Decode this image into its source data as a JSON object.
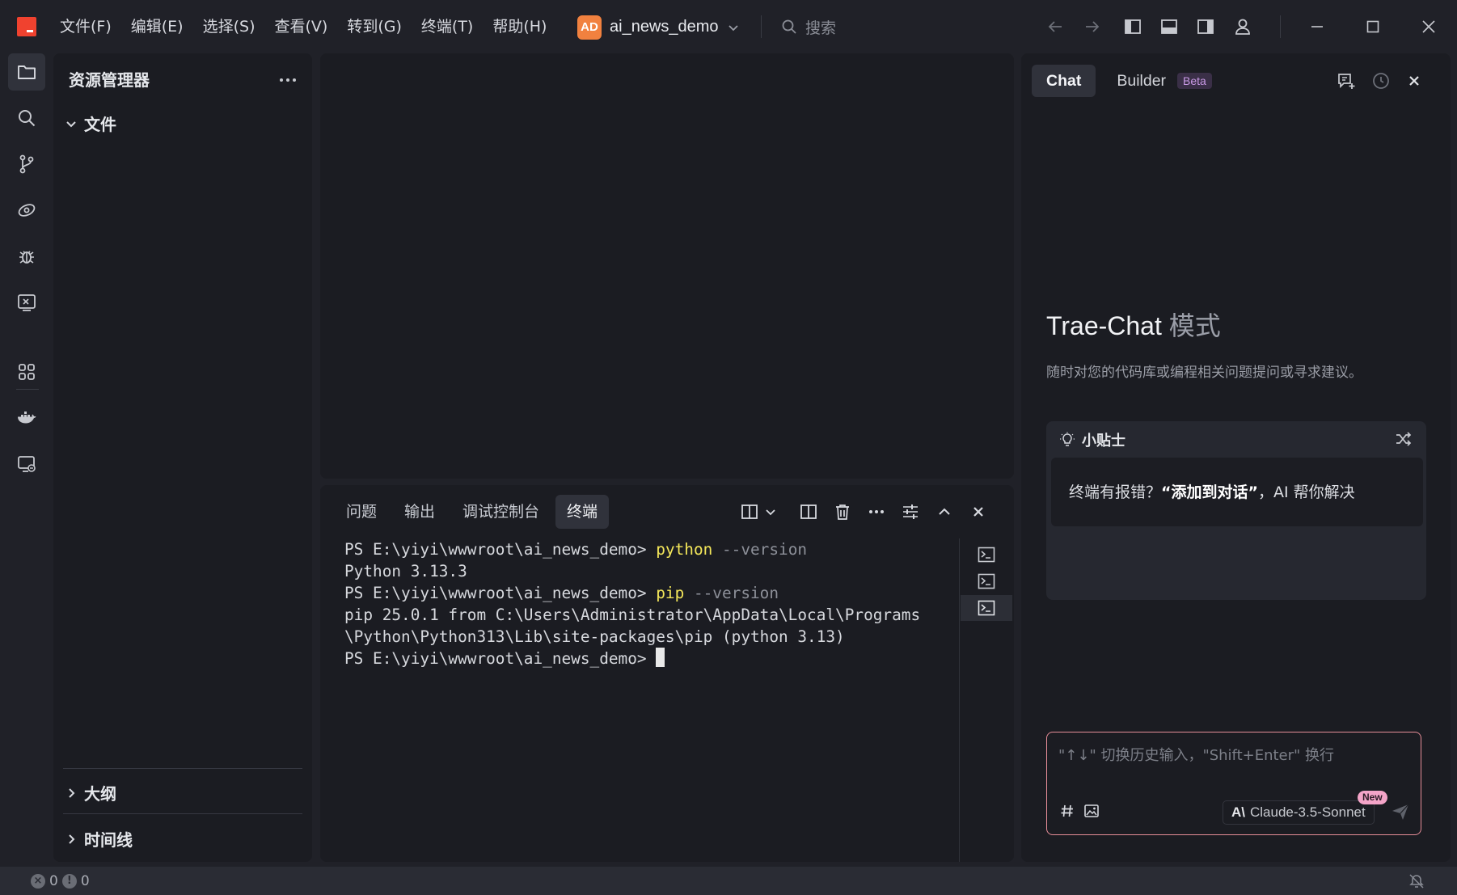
{
  "titlebar": {
    "menus": [
      "文件(F)",
      "编辑(E)",
      "选择(S)",
      "查看(V)",
      "转到(G)",
      "终端(T)",
      "帮助(H)"
    ],
    "project_avatar": "AD",
    "project_name": "ai_news_demo",
    "search_label": "搜索",
    "colors": {
      "logo": "#f0422f",
      "avatar": "#f1813f"
    }
  },
  "activitybar": {
    "icons": [
      "explorer-icon",
      "search-icon",
      "source-control-icon",
      "remote-icon",
      "debug-icon",
      "terminal-box-icon",
      "extensions-icon",
      "docker-icon",
      "remote-explorer-icon"
    ]
  },
  "explorer": {
    "title": "资源管理器",
    "folder_section": "文件",
    "outline_section": "大纲",
    "timeline_section": "时间线"
  },
  "panel": {
    "tabs": [
      "问题",
      "输出",
      "调试控制台",
      "终端"
    ],
    "active_tab": "终端",
    "terminal": {
      "prompt": "PS E:\\yiyi\\wwwroot\\ai_news_demo> ",
      "lines": [
        {
          "prompt": "PS E:\\yiyi\\wwwroot\\ai_news_demo> ",
          "cmd": "python",
          "args": " --version"
        },
        {
          "output": "Python 3.13.3"
        },
        {
          "prompt": "PS E:\\yiyi\\wwwroot\\ai_news_demo> ",
          "cmd": "pip",
          "args": " --version"
        },
        {
          "output": "pip 25.0.1 from C:\\Users\\Administrator\\AppData\\Local\\Programs"
        },
        {
          "output": "\\Python\\Python313\\Lib\\site-packages\\pip (python 3.13)"
        },
        {
          "prompt": "PS E:\\yiyi\\wwwroot\\ai_news_demo> ",
          "cursor": true
        }
      ]
    }
  },
  "chat": {
    "tabs": {
      "chat": "Chat",
      "builder": "Builder",
      "builder_badge": "Beta"
    },
    "mode_title": "Trae-Chat",
    "mode_suffix": "模式",
    "mode_desc": "随时对您的代码库或编程相关问题提问或寻求建议。",
    "tips": {
      "title": "小贴士",
      "text_before": "终端有报错？",
      "text_bold": "“添加到对话”",
      "text_after": "，AI 帮你解决"
    },
    "input": {
      "placeholder": "\"↑↓\" 切换历史输入，\"Shift+Enter\" 换行",
      "model_logo": "A\\",
      "model_name": "Claude-3.5-Sonnet",
      "model_badge": "New"
    },
    "colors": {
      "input_border": "#e68d98",
      "badge": "#f4a4c8"
    }
  },
  "statusbar": {
    "errors": "0",
    "warnings": "0"
  }
}
